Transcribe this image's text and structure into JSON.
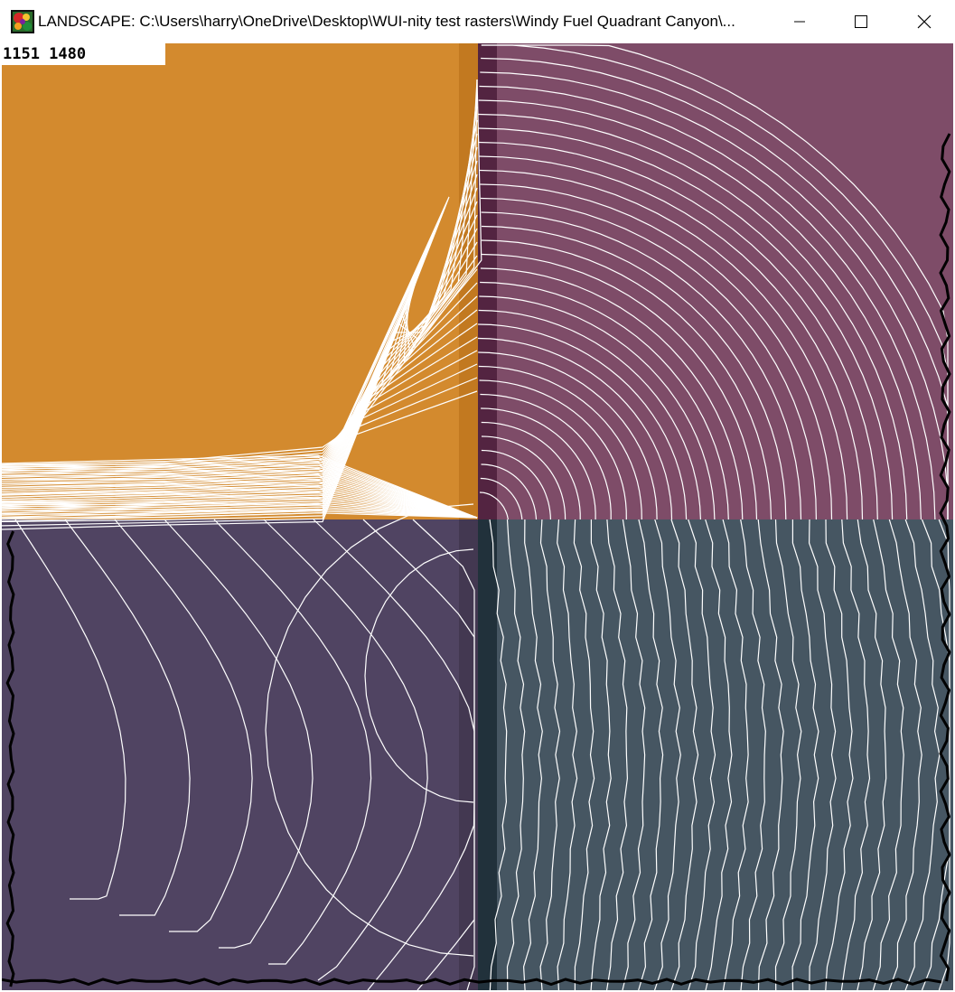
{
  "window": {
    "title": "LANDSCAPE: C:\\Users\\harry\\OneDrive\\Desktop\\WUI-nity test rasters\\Windy Fuel Quadrant Canyon\\...",
    "icon": "landscape-app-icon",
    "buttons": {
      "minimize": "minimize-icon",
      "maximize": "maximize-icon",
      "close": "close-icon"
    }
  },
  "readout": {
    "coordinates": "1151 1480"
  },
  "colors": {
    "quadrant_top_left": "#d38a2e",
    "quadrant_top_right": "#7e4c68",
    "quadrant_bottom_left": "#504462",
    "quadrant_bottom_right": "#465662",
    "canyon_top_left": "#c27920",
    "canyon_top_right": "#532441",
    "canyon_bottom_left": "#433851",
    "canyon_bottom_right": "#21313b",
    "contour": "#ffffff",
    "burn_edge": "#000000"
  }
}
